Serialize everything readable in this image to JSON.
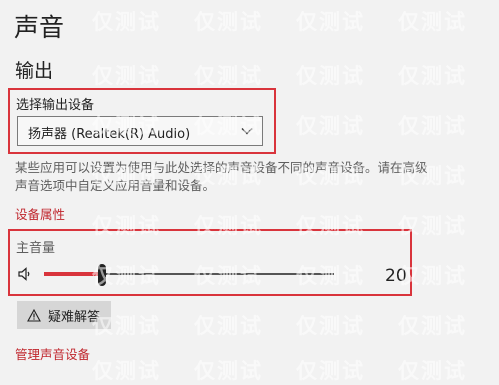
{
  "page": {
    "title": "声音",
    "output_section_title": "输出"
  },
  "output_device": {
    "label": "选择输出设备",
    "selected": "扬声器 (Realtek(R) Audio)"
  },
  "description": "某些应用可以设置为使用与此处选择的声音设备不同的声音设备。请在高级声音选项中自定义应用音量和设备。",
  "device_properties_link": "设备属性",
  "master_volume": {
    "label": "主音量",
    "value": "20",
    "level": 0.2
  },
  "troubleshoot_button": "疑难解答",
  "manage_devices_link": "管理声音设备",
  "watermark_text": "仅测试",
  "colors": {
    "accent": "#d9343c",
    "background": "#f2f2f2",
    "highlight_border": "#d9343c"
  },
  "icons": {
    "chevron": "chevron-down-icon",
    "speaker": "speaker-icon",
    "warning": "warning-icon"
  }
}
